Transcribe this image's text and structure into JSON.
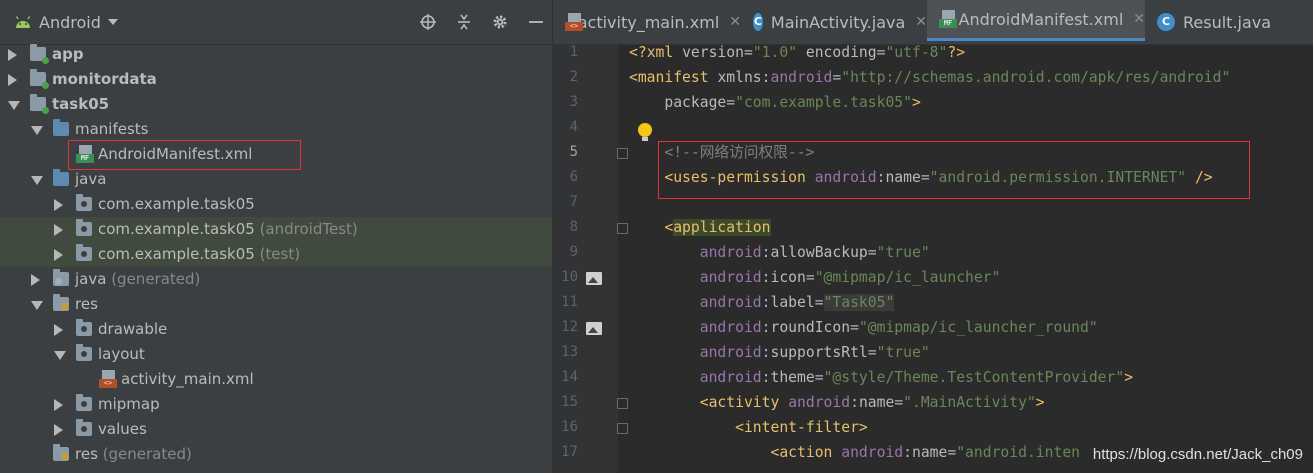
{
  "project_panel": {
    "view_label": "Android",
    "tree": [
      {
        "label": "app",
        "suffix": "",
        "bold": true,
        "indent": 0,
        "expanded": false,
        "icon": "module-folder-icon"
      },
      {
        "label": "monitordata",
        "suffix": "",
        "bold": true,
        "indent": 0,
        "expanded": false,
        "icon": "module-folder-icon"
      },
      {
        "label": "task05",
        "suffix": "",
        "bold": true,
        "indent": 0,
        "expanded": true,
        "icon": "module-folder-icon"
      },
      {
        "label": "manifests",
        "suffix": "",
        "bold": false,
        "indent": 1,
        "expanded": true,
        "icon": "folder-icon"
      },
      {
        "label": "AndroidManifest.xml",
        "suffix": "",
        "bold": false,
        "indent": 2,
        "expanded": null,
        "icon": "manifest-file-icon"
      },
      {
        "label": "java",
        "suffix": "",
        "bold": false,
        "indent": 1,
        "expanded": true,
        "icon": "folder-icon"
      },
      {
        "label": "com.example.task05",
        "suffix": "",
        "bold": false,
        "indent": 2,
        "expanded": false,
        "icon": "package-icon"
      },
      {
        "label": "com.example.task05",
        "suffix": " (androidTest)",
        "bold": false,
        "indent": 2,
        "expanded": false,
        "icon": "package-icon"
      },
      {
        "label": "com.example.task05",
        "suffix": " (test)",
        "bold": false,
        "indent": 2,
        "expanded": false,
        "icon": "package-icon"
      },
      {
        "label": "java",
        "suffix": " (generated)",
        "bold": false,
        "indent": 1,
        "expanded": false,
        "icon": "generated-folder-icon"
      },
      {
        "label": "res",
        "suffix": "",
        "bold": false,
        "indent": 1,
        "expanded": true,
        "icon": "res-folder-icon"
      },
      {
        "label": "drawable",
        "suffix": "",
        "bold": false,
        "indent": 2,
        "expanded": false,
        "icon": "package-icon"
      },
      {
        "label": "layout",
        "suffix": "",
        "bold": false,
        "indent": 2,
        "expanded": true,
        "icon": "package-icon"
      },
      {
        "label": "activity_main.xml",
        "suffix": "",
        "bold": false,
        "indent": 3,
        "expanded": null,
        "icon": "layout-xml-file-icon"
      },
      {
        "label": "mipmap",
        "suffix": "",
        "bold": false,
        "indent": 2,
        "expanded": false,
        "icon": "package-icon"
      },
      {
        "label": "values",
        "suffix": "",
        "bold": false,
        "indent": 2,
        "expanded": false,
        "icon": "package-icon"
      },
      {
        "label": "res",
        "suffix": " (generated)",
        "bold": false,
        "indent": 1,
        "expanded": null,
        "icon": "res-folder-icon"
      }
    ]
  },
  "editor": {
    "tabs": [
      {
        "label": "activity_main.xml",
        "icon": "layout-xml-file-icon",
        "active": false
      },
      {
        "label": "MainActivity.java",
        "icon": "class-icon",
        "active": false
      },
      {
        "label": "AndroidManifest.xml",
        "icon": "manifest-file-icon",
        "active": true
      },
      {
        "label": "Result.java",
        "icon": "class-icon",
        "active": false
      }
    ],
    "line_numbers": [
      "1",
      "2",
      "3",
      "4",
      "5",
      "6",
      "7",
      "8",
      "9",
      "10",
      "11",
      "12",
      "13",
      "14",
      "15",
      "16",
      "17"
    ],
    "code_lines": [
      [
        [
          "tk-punc",
          "<?"
        ],
        [
          "tk-tag",
          "xml "
        ],
        [
          "tk-at",
          "version"
        ],
        [
          "",
          "="
        ],
        [
          "tk-val",
          "\"1.0\""
        ],
        [
          "tk-at",
          " encoding"
        ],
        [
          "",
          "="
        ],
        [
          "tk-val",
          "\"utf-8\""
        ],
        [
          "tk-punc",
          "?>"
        ]
      ],
      [
        [
          "tk-tag",
          "<manifest "
        ],
        [
          "tk-at",
          "xmlns:"
        ],
        [
          "tk-ns",
          "android"
        ],
        [
          "",
          "="
        ],
        [
          "tk-val",
          "\"http://schemas.android.com/apk/res/android\""
        ]
      ],
      [
        [
          "",
          "    "
        ],
        [
          "tk-at",
          "package"
        ],
        [
          "",
          "="
        ],
        [
          "tk-val",
          "\"com.example.task05\""
        ],
        [
          "tk-tag",
          ">"
        ]
      ],
      [],
      [
        [
          "",
          "    "
        ],
        [
          "tk-com",
          "<!--网络访问权限-->"
        ]
      ],
      [
        [
          "",
          "    "
        ],
        [
          "tk-tag",
          "<uses-permission "
        ],
        [
          "tk-ns",
          "android"
        ],
        [
          "",
          ":"
        ],
        [
          "tk-at",
          "name"
        ],
        [
          "",
          "="
        ],
        [
          "tk-val",
          "\"android.permission.INTERNET\""
        ],
        [
          "tk-tag",
          " />"
        ]
      ],
      [],
      [
        [
          "",
          "    "
        ],
        [
          "tk-tag",
          "<"
        ],
        [
          "tag-hl",
          "application"
        ]
      ],
      [
        [
          "",
          "        "
        ],
        [
          "tk-ns",
          "android"
        ],
        [
          "",
          ":"
        ],
        [
          "tk-at",
          "allowBackup"
        ],
        [
          "",
          "="
        ],
        [
          "tk-val",
          "\"true\""
        ]
      ],
      [
        [
          "",
          "        "
        ],
        [
          "tk-ns",
          "android"
        ],
        [
          "",
          ":"
        ],
        [
          "tk-at",
          "icon"
        ],
        [
          "",
          "="
        ],
        [
          "tk-val",
          "\"@mipmap/ic_launcher\""
        ]
      ],
      [
        [
          "",
          "        "
        ],
        [
          "tk-ns",
          "android"
        ],
        [
          "",
          ":"
        ],
        [
          "tk-at",
          "label"
        ],
        [
          "",
          "="
        ],
        [
          "tk-valhl",
          "\"Task05\""
        ]
      ],
      [
        [
          "",
          "        "
        ],
        [
          "tk-ns",
          "android"
        ],
        [
          "",
          ":"
        ],
        [
          "tk-at",
          "roundIcon"
        ],
        [
          "",
          "="
        ],
        [
          "tk-val",
          "\"@mipmap/ic_launcher_round\""
        ]
      ],
      [
        [
          "",
          "        "
        ],
        [
          "tk-ns",
          "android"
        ],
        [
          "",
          ":"
        ],
        [
          "tk-at",
          "supportsRtl"
        ],
        [
          "",
          "="
        ],
        [
          "tk-val",
          "\"true\""
        ]
      ],
      [
        [
          "",
          "        "
        ],
        [
          "tk-ns",
          "android"
        ],
        [
          "",
          ":"
        ],
        [
          "tk-at",
          "theme"
        ],
        [
          "",
          "="
        ],
        [
          "tk-val",
          "\"@style/Theme.TestContentProvider\""
        ],
        [
          "tk-tag",
          ">"
        ]
      ],
      [
        [
          "",
          "        "
        ],
        [
          "tk-tag",
          "<activity "
        ],
        [
          "tk-ns",
          "android"
        ],
        [
          "",
          ":"
        ],
        [
          "tk-at",
          "name"
        ],
        [
          "",
          "="
        ],
        [
          "tk-val",
          "\".MainActivity\""
        ],
        [
          "tk-tag",
          ">"
        ]
      ],
      [
        [
          "",
          "            "
        ],
        [
          "tk-tag",
          "<intent-filter>"
        ]
      ],
      [
        [
          "",
          "                "
        ],
        [
          "tk-tag",
          "<action "
        ],
        [
          "tk-ns",
          "android"
        ],
        [
          "",
          ":"
        ],
        [
          "tk-at",
          "name"
        ],
        [
          "",
          "="
        ],
        [
          "tk-val",
          "\"android.inten"
        ]
      ]
    ]
  },
  "watermark": "https://blog.csdn.net/Jack_ch09",
  "colors": {
    "accent": "#4a88c7",
    "highlight_box": "#e0333a",
    "panel_bg": "#3c3f41",
    "editor_bg": "#2b2b2b"
  }
}
